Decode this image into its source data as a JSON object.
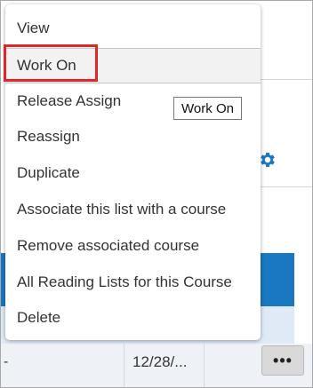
{
  "menu": {
    "items": [
      {
        "label": "View"
      },
      {
        "label": "Work On"
      },
      {
        "label": "Release Assign"
      },
      {
        "label": "Reassign"
      },
      {
        "label": "Duplicate"
      },
      {
        "label": "Associate this list with a course"
      },
      {
        "label": "Remove associated course"
      },
      {
        "label": "All Reading Lists for this Course"
      },
      {
        "label": "Delete"
      }
    ],
    "highlighted_item": "Work On"
  },
  "tooltip": {
    "text": "Work On"
  },
  "background": {
    "date_cell": "12/28/...",
    "dash_cell": "-",
    "more_button_label": "•••",
    "gear_icon": "gear-icon"
  },
  "colors": {
    "focus_outline": "#e0252b",
    "header_band": "#1a78c2",
    "gear": "#1a78c2"
  }
}
